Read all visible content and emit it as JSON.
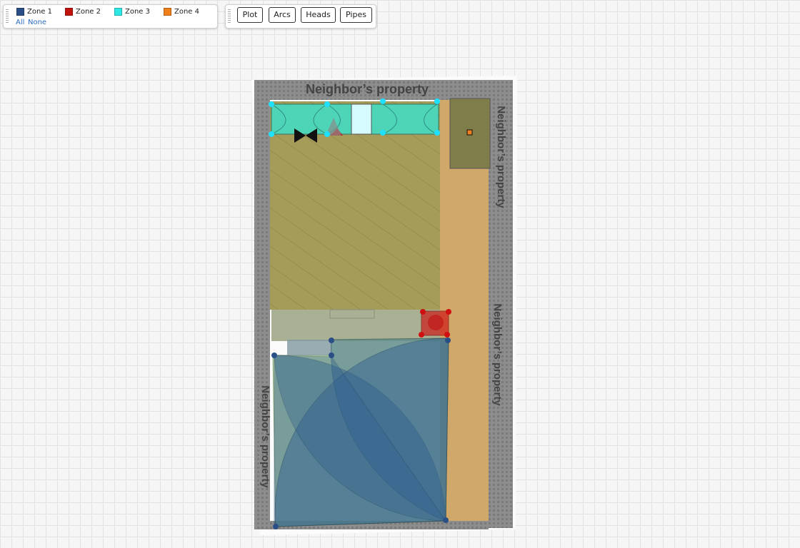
{
  "zones_panel": {
    "zones": [
      {
        "label": "Zone 1",
        "color": "#2a4f86"
      },
      {
        "label": "Zone 2",
        "color": "#c0140c"
      },
      {
        "label": "Zone 3",
        "color": "#2ee8e8"
      },
      {
        "label": "Zone 4",
        "color": "#ef7f1a"
      }
    ],
    "all_label": "All",
    "none_label": "None"
  },
  "toolbar": {
    "buttons": [
      "Plot",
      "Arcs",
      "Heads",
      "Pipes"
    ]
  },
  "plan": {
    "neighbor_label": "Neighbor’s property",
    "colors": {
      "wall": "#8a8a8a",
      "lawn": "#a69c5a",
      "walkway": "#d0a86a",
      "shed": "#7f7d4a",
      "zone1_fill": "#2f5f8f",
      "zone1_head": "#2a4f86",
      "zone2_head": "#d01010",
      "zone3_fill": "#3fe0c8",
      "zone3_head": "#20e0ff",
      "zone4_head": "#ef7f1a"
    }
  }
}
